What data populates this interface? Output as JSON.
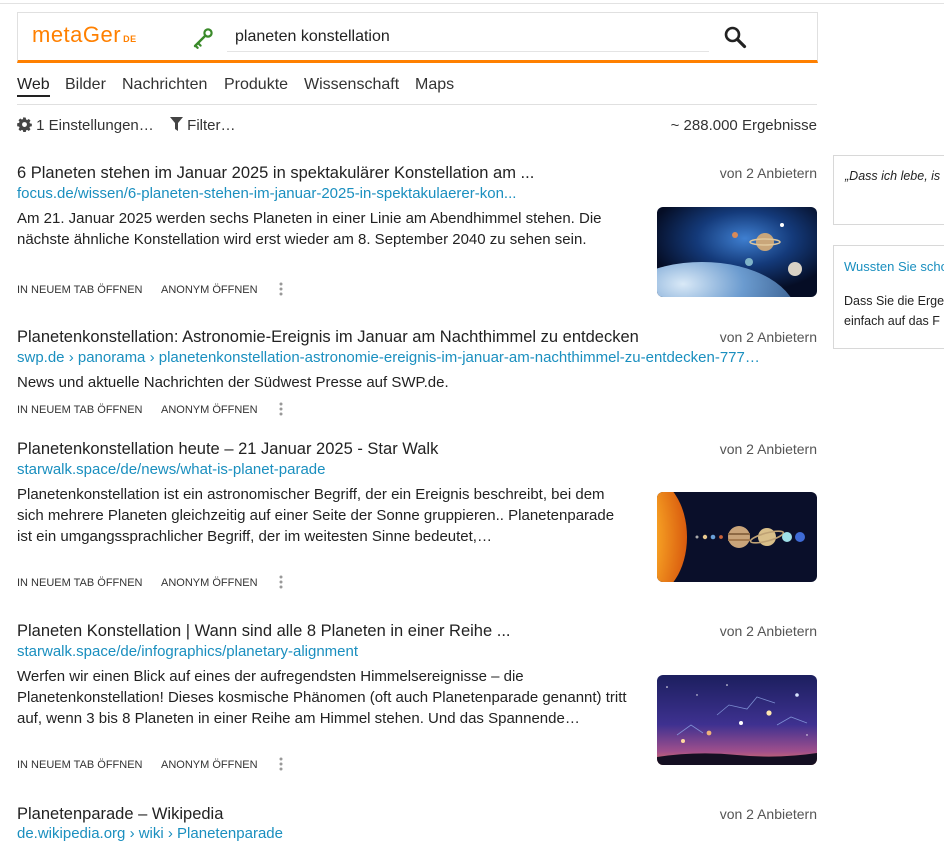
{
  "search": {
    "logo_text": "metaGer",
    "logo_tld": "DE",
    "query": "planeten konstellation"
  },
  "tabs": [
    {
      "label": "Web",
      "active": true
    },
    {
      "label": "Bilder"
    },
    {
      "label": "Nachrichten"
    },
    {
      "label": "Produkte"
    },
    {
      "label": "Wissenschaft"
    },
    {
      "label": "Maps"
    }
  ],
  "toolbar": {
    "settings_label": "1 Einstellungen…",
    "filter_label": "Filter…",
    "result_count": "~ 288.000 Ergebnisse"
  },
  "results": [
    {
      "title": "6 Planeten stehen im Januar 2025 in spektakulärer Konstellation am ...",
      "from": "von 2 Anbietern",
      "url": "focus.de/wissen/6-planeten-stehen-im-januar-2025-in-spektakulaerer-kon...",
      "description": "Am 21. Januar 2025 werden sechs Planeten in einer Linie am Abendhimmel stehen. Die nächste ähnliche Konstellation wird erst wieder am 8. September 2040 zu sehen sein.",
      "open_new_tab": "IN NEUEM TAB ÖFFNEN",
      "open_anonymous": "ANONYM ÖFFNEN"
    },
    {
      "title": "Planetenkonstellation: Astronomie-Ereignis im Januar am Nachthimmel zu entdecken",
      "from": "von 2 Anbietern",
      "url": "swp.de › panorama › planetenkonstellation-astronomie-ereignis-im-januar-am-nachthimmel-zu-entdecken-777…",
      "description": "News und aktuelle Nachrichten der Südwest Presse auf SWP.de.",
      "open_new_tab": "IN NEUEM TAB ÖFFNEN",
      "open_anonymous": "ANONYM ÖFFNEN"
    },
    {
      "title": "Planetenkonstellation heute – 21 Januar 2025 - Star Walk",
      "from": "von 2 Anbietern",
      "url": "starwalk.space/de/news/what-is-planet-parade",
      "description": "Planetenkonstellation ist ein astronomischer Begriff, der ein Ereignis beschreibt, bei dem sich mehrere Planeten gleichzeitig auf einer Seite der Sonne gruppieren.. Planetenparade ist ein umgangssprachlicher Begriff, der im weitesten Sinne bedeutet,…",
      "open_new_tab": "IN NEUEM TAB ÖFFNEN",
      "open_anonymous": "ANONYM ÖFFNEN"
    },
    {
      "title": "Planeten Konstellation | Wann sind alle 8 Planeten in einer Reihe ...",
      "from": "von 2 Anbietern",
      "url": "starwalk.space/de/infographics/planetary-alignment",
      "description": "Werfen wir einen Blick auf eines der aufregendsten Himmelsereignisse – die Planetenkonstellation! Dieses kosmische Phänomen (oft auch Planetenparade genannt) tritt auf, wenn 3 bis 8 Planeten in einer Reihe am Himmel stehen. Und das Spannende…",
      "open_new_tab": "IN NEUEM TAB ÖFFNEN",
      "open_anonymous": "ANONYM ÖFFNEN"
    },
    {
      "title": "Planetenparade – Wikipedia",
      "from": "von 2 Anbietern",
      "url": "de.wikipedia.org › wiki › Planetenparade"
    }
  ],
  "sidebar": {
    "quote": "„Dass ich lebe, is",
    "fact_title": "Wussten Sie scho",
    "fact_line1": "Dass Sie die Erge",
    "fact_line2": "einfach auf das F"
  }
}
